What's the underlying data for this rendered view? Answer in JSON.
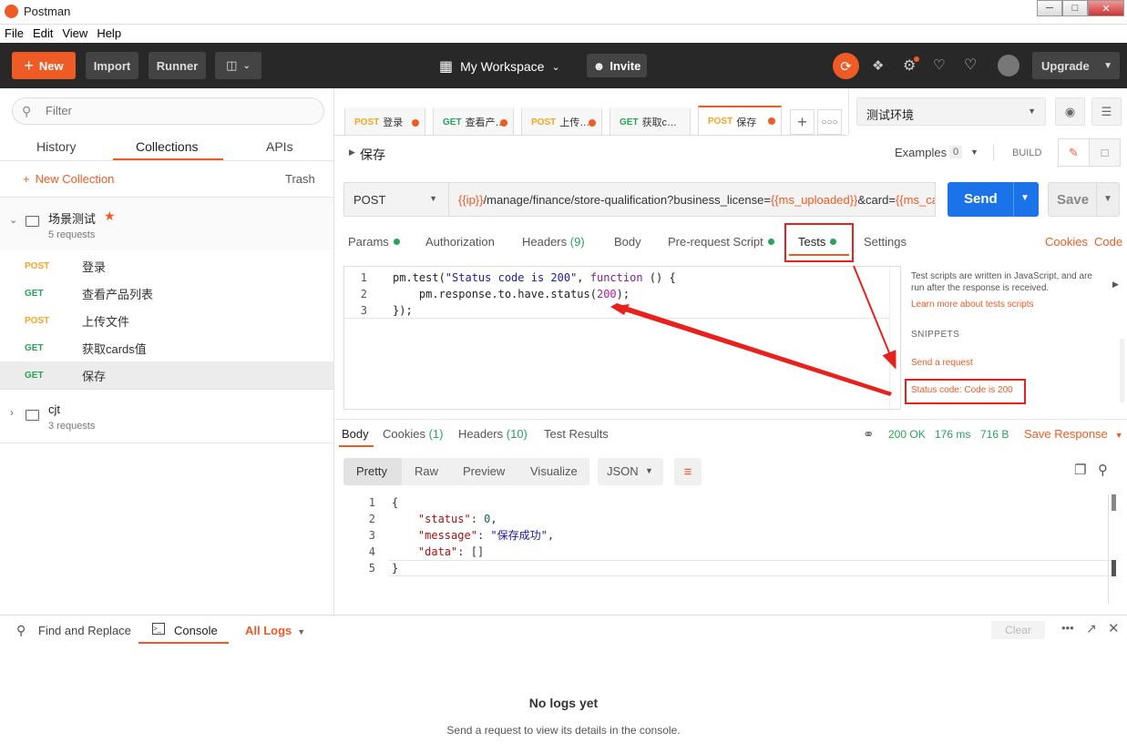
{
  "window": {
    "title": "Postman",
    "controls": [
      "minimize",
      "maximize",
      "close"
    ]
  },
  "menu": [
    "File",
    "Edit",
    "View",
    "Help"
  ],
  "header": {
    "new_label": "New",
    "import_label": "Import",
    "runner_label": "Runner",
    "workspace": "My Workspace",
    "invite": "Invite",
    "upgrade": "Upgrade"
  },
  "sidebar": {
    "filter_placeholder": "Filter",
    "tabs": [
      "History",
      "Collections",
      "APIs"
    ],
    "new_collection": "New Collection",
    "trash": "Trash",
    "collections": [
      {
        "name": "场景测试",
        "count": "5 requests",
        "requests": [
          {
            "method": "POST",
            "name": "登录"
          },
          {
            "method": "GET",
            "name": "查看产品列表"
          },
          {
            "method": "POST",
            "name": "上传文件"
          },
          {
            "method": "GET",
            "name": "获取cards值"
          },
          {
            "method": "GET",
            "name": "保存"
          }
        ]
      },
      {
        "name": "cjt",
        "count": "3 requests"
      }
    ]
  },
  "tabs": [
    {
      "method": "POST",
      "name": "登录"
    },
    {
      "method": "GET",
      "name": "查看产…"
    },
    {
      "method": "POST",
      "name": "上传…"
    },
    {
      "method": "GET",
      "name": "获取c…"
    },
    {
      "method": "POST",
      "name": "保存"
    }
  ],
  "environment": "测试环境",
  "request": {
    "name": "保存",
    "examples_label": "Examples",
    "examples_count": "0",
    "build": "BUILD",
    "method": "POST",
    "url_parts": [
      {
        "t": "{{ip}}",
        "v": true
      },
      {
        "t": "/manage/finance/store-qualification?business_license=",
        "v": false
      },
      {
        "t": "{{ms_uploaded}}",
        "v": true
      },
      {
        "t": "&card=",
        "v": false
      },
      {
        "t": "{{ms_car",
        "v": true
      }
    ],
    "send": "Send",
    "save": "Save"
  },
  "req_tabs": {
    "params": "Params",
    "authorization": "Authorization",
    "headers": "Headers",
    "headers_count": "(9)",
    "body": "Body",
    "prerequest": "Pre-request Script",
    "tests": "Tests",
    "settings": "Settings",
    "cookies": "Cookies",
    "code": "Code"
  },
  "tests_code": [
    {
      "n": "1"
    },
    {
      "n": "2"
    },
    {
      "n": "3"
    }
  ],
  "snippets": {
    "info": "Test scripts are written in JavaScript, and are run after the response is received.",
    "learn": "Learn more about tests scripts",
    "heading": "SNIPPETS",
    "send_request": "Send a request",
    "status_code": "Status code: Code is 200"
  },
  "response": {
    "tabs": {
      "body": "Body",
      "cookies": "Cookies",
      "cookies_count": "(1)",
      "headers": "Headers",
      "headers_count": "(10)",
      "test_results": "Test Results"
    },
    "status": "200 OK",
    "time": "176 ms",
    "size": "716 B",
    "save_response": "Save Response",
    "views": [
      "Pretty",
      "Raw",
      "Preview",
      "Visualize"
    ],
    "format": "JSON",
    "lines": [
      "1",
      "2",
      "3",
      "4",
      "5"
    ]
  },
  "console": {
    "find_replace": "Find and Replace",
    "console": "Console",
    "all_logs": "All Logs",
    "clear": "Clear",
    "empty_title": "No logs yet",
    "empty_sub": "Send a request to view its details in the console."
  },
  "colors": {
    "accent": "#ef5b25",
    "send": "#1a73e8",
    "header_bg": "#282828",
    "get": "#27a35a",
    "post": "#f5a623",
    "annotation": "#e8211d"
  }
}
